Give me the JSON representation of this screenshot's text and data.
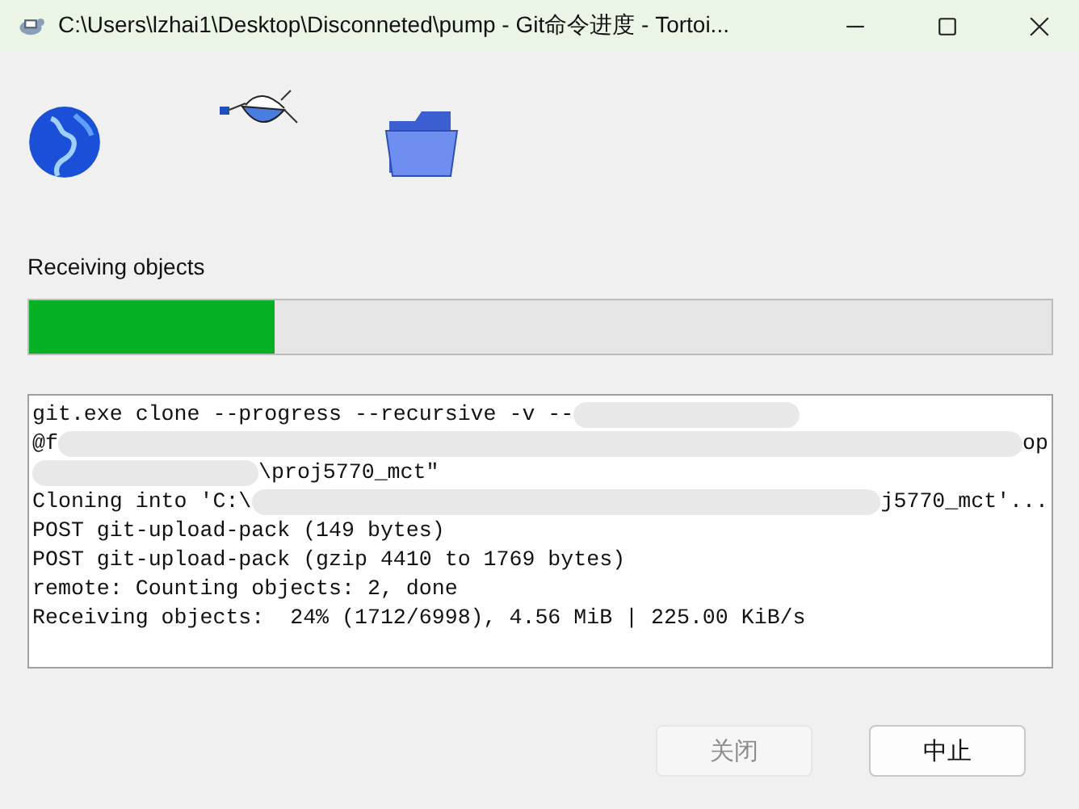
{
  "window": {
    "title": "C:\\Users\\lzhai1\\Desktop\\Disconneted\\pump - Git命令进度 - Tortoi..."
  },
  "status": {
    "label": "Receiving objects",
    "level": 0.24
  },
  "log": [
    {
      "segments": [
        {
          "kind": "text",
          "text": "git.exe clone --progress --recursive -v --"
        },
        {
          "kind": "redacted"
        }
      ]
    },
    {
      "segments": [
        {
          "kind": "text",
          "text": "@f"
        },
        {
          "kind": "redacted"
        },
        {
          "kind": "text",
          "text": "op"
        }
      ]
    },
    {
      "segments": [
        {
          "kind": "redacted"
        },
        {
          "kind": "text",
          "text": "\\proj5770_mct\""
        }
      ]
    },
    {
      "segments": [
        {
          "kind": "text",
          "text": "Cloning into 'C:\\"
        },
        {
          "kind": "redacted"
        },
        {
          "kind": "text",
          "text": "j5770_mct'..."
        }
      ]
    },
    {
      "segments": [
        {
          "kind": "text",
          "text": "POST git-upload-pack (149 bytes)"
        }
      ]
    },
    {
      "segments": [
        {
          "kind": "text",
          "text": "POST git-upload-pack (gzip 4410 to 1769 bytes)"
        }
      ]
    },
    {
      "segments": [
        {
          "kind": "text",
          "text": "remote: Counting objects: 2, done"
        }
      ]
    },
    {
      "segments": [
        {
          "kind": "text",
          "text": "Receiving objects:  24% (1712/6998), 4.56 MiB | 225.00 KiB/s"
        }
      ]
    }
  ],
  "buttons": [
    {
      "label": "关闭",
      "disabled": true
    },
    {
      "label": "中止",
      "disabled": false
    }
  ]
}
